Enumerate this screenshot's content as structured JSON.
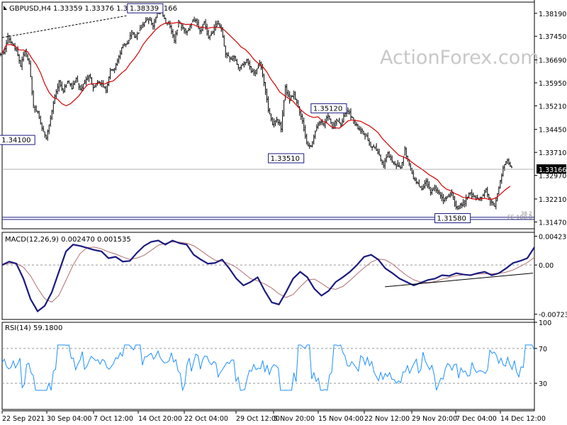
{
  "header": {
    "symbol": "GBPUSD,H4",
    "ohlc": "1.33359 1.33376 1.33155 1.33166"
  },
  "watermark": "ActionForex.com",
  "colors": {
    "bar": "#000000",
    "ma": "#d40000",
    "macd_main": "#1a1a80",
    "macd_signal": "#b07070",
    "rsi": "#1e90ff",
    "trendline": "#000000",
    "grid_dashed": "#999999"
  },
  "chart_data": [
    {
      "type": "line",
      "title": "GBPUSD,H4 1.33359 1.33376 1.33155 1.33166",
      "xlabel": "",
      "ylabel": "",
      "x_ticks": [
        "22 Sep 2021",
        "30 Sep 04:00",
        "7 Oct 12:00",
        "14 Oct 20:00",
        "22 Oct 04:00",
        "29 Oct 12:00",
        "5 Nov 20:00",
        "15 Nov 04:00",
        "22 Nov 12:00",
        "29 Nov 20:00",
        "7 Dec 04:00",
        "14 Dec 12:00"
      ],
      "y_ticks": [
        "1.38190",
        "1.37450",
        "1.36690",
        "1.35950",
        "1.35210",
        "1.34450",
        "1.33710",
        "1.32970",
        "1.32210",
        "1.31470"
      ],
      "ylim": [
        1.3125,
        1.3855
      ],
      "current_price": "1.33166",
      "series_x": [
        0,
        6,
        12,
        18,
        24,
        30,
        36,
        42,
        48,
        54,
        60,
        66,
        72,
        78,
        84,
        90,
        96,
        102,
        108,
        114,
        120,
        126,
        132,
        138,
        144,
        150,
        156,
        162,
        168,
        174,
        180,
        186,
        192,
        198,
        204,
        210,
        216,
        222,
        228,
        234,
        240,
        246,
        252,
        258,
        264,
        270,
        276,
        282,
        288,
        294,
        300,
        306,
        312,
        318,
        324,
        330,
        336,
        342,
        348,
        354,
        360,
        366,
        372,
        378,
        384,
        390,
        396,
        402,
        408,
        414,
        420,
        426,
        432,
        438,
        444,
        450,
        456,
        462,
        468,
        474,
        480,
        486,
        492,
        498,
        504,
        510,
        516,
        522,
        528,
        534,
        540,
        546,
        552,
        558,
        564,
        570,
        576,
        582,
        588,
        594,
        600,
        606,
        612,
        618,
        624,
        630,
        636,
        642,
        648,
        654,
        660,
        666,
        672,
        678,
        684,
        690,
        696,
        702,
        708,
        714,
        720,
        726,
        732,
        738
      ],
      "close": [
        1.369,
        1.3745,
        1.372,
        1.37,
        1.365,
        1.37,
        1.366,
        1.352,
        1.35,
        1.345,
        1.342,
        1.348,
        1.355,
        1.36,
        1.357,
        1.36,
        1.358,
        1.361,
        1.357,
        1.36,
        1.362,
        1.358,
        1.36,
        1.359,
        1.357,
        1.364,
        1.364,
        1.368,
        1.372,
        1.372,
        1.376,
        1.374,
        1.377,
        1.379,
        1.38,
        1.378,
        1.382,
        1.3825,
        1.379,
        1.378,
        1.373,
        1.379,
        1.377,
        1.376,
        1.379,
        1.38,
        1.376,
        1.379,
        1.374,
        1.376,
        1.379,
        1.377,
        1.369,
        1.367,
        1.368,
        1.364,
        1.365,
        1.367,
        1.363,
        1.363,
        1.366,
        1.36,
        1.351,
        1.346,
        1.348,
        1.345,
        1.358,
        1.354,
        1.356,
        1.352,
        1.347,
        1.34,
        1.339,
        1.344,
        1.347,
        1.346,
        1.349,
        1.345,
        1.348,
        1.346,
        1.35,
        1.35,
        1.347,
        1.345,
        1.344,
        1.342,
        1.339,
        1.339,
        1.336,
        1.333,
        1.337,
        1.334,
        1.333,
        1.332,
        1.338,
        1.333,
        1.329,
        1.327,
        1.325,
        1.328,
        1.324,
        1.326,
        1.324,
        1.322,
        1.323,
        1.324,
        1.319,
        1.32,
        1.321,
        1.324,
        1.323,
        1.322,
        1.323,
        1.325,
        1.321,
        1.32,
        1.326,
        1.332,
        1.335,
        1.332
      ],
      "annotations": [
        {
          "label": "1.38339",
          "x": 228,
          "y": 1.3834,
          "side": "left"
        },
        {
          "label": "1.34100",
          "x": 48,
          "y": 1.341,
          "side": "left"
        },
        {
          "label": "1.33510",
          "x": 426,
          "y": 1.3351,
          "side": "left"
        },
        {
          "label": "1.35120",
          "x": 486,
          "y": 1.3512,
          "side": "left"
        },
        {
          "label": "1.31580",
          "x": 660,
          "y": 1.3158,
          "side": "left"
        }
      ],
      "fe_label": "FE 100.0",
      "fe_small": "38.2"
    },
    {
      "type": "line",
      "title": "MACD(12,26,9) 0.002470 0.001535",
      "y_ticks": [
        "0.004231",
        "0.00",
        "-0.00723"
      ],
      "ylim": [
        -0.008,
        0.0048
      ],
      "main": [
        0.0,
        0.0005,
        0.0002,
        -0.002,
        -0.005,
        -0.0068,
        -0.006,
        -0.004,
        -0.001,
        0.002,
        0.003,
        0.0028,
        0.0025,
        0.0022,
        0.002,
        0.001,
        0.0012,
        0.0005,
        0.0006,
        0.0018,
        0.0028,
        0.0034,
        0.0036,
        0.003,
        0.0036,
        0.0032,
        0.003,
        0.0015,
        0.0008,
        0.0002,
        0.0003,
        0.0008,
        -0.0005,
        -0.002,
        -0.003,
        -0.0025,
        -0.0018,
        -0.0038,
        -0.0055,
        -0.0058,
        -0.004,
        -0.002,
        -0.001,
        -0.0018,
        -0.0035,
        -0.0045,
        -0.0038,
        -0.0025,
        -0.0018,
        -0.001,
        0.0,
        0.0012,
        0.0015,
        0.0008,
        -0.0005,
        -0.0012,
        -0.002,
        -0.0025,
        -0.003,
        -0.0026,
        -0.0022,
        -0.002,
        -0.0015,
        -0.0016,
        -0.0012,
        -0.0014,
        -0.0015,
        -0.0012,
        -0.001,
        -0.0015,
        -0.0012,
        -0.0005,
        0.0003,
        0.0006,
        0.001,
        0.0026
      ],
      "signal_offset": 0.0008,
      "trendline": {
        "x0": 538,
        "y0": -0.0032,
        "x1": 752,
        "y1": -0.0012
      }
    },
    {
      "type": "line",
      "title": "RSI(14) 59.1800",
      "y_ticks": [
        "100",
        "70",
        "30"
      ],
      "ylim": [
        0,
        100
      ],
      "levels": [
        70,
        30
      ]
    }
  ]
}
